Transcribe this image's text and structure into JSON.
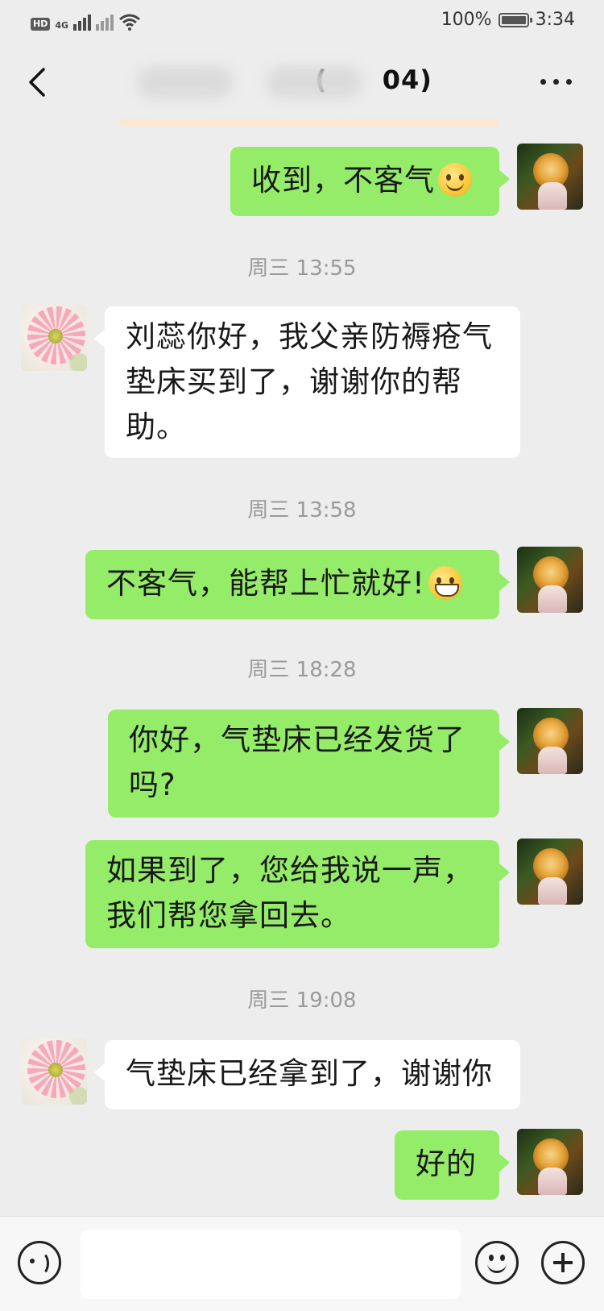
{
  "status_bar": {
    "hd_label": "HD",
    "network_label": "4G",
    "battery_percent": "100%",
    "battery_level": 1.0,
    "time": "3:34"
  },
  "header": {
    "title": "(",
    "title_suffix": "04)",
    "back_icon": "chevron-left-icon",
    "more_icon": "more-dots-icon"
  },
  "messages": [
    {
      "side": "self",
      "text": "收到，不客气",
      "emoji": "smile-emoji"
    },
    {
      "type": "time",
      "text": "周三 13:55"
    },
    {
      "side": "other",
      "lines": [
        "刘蕊你好，我父亲防褥疮气",
        "垫床买到了，谢谢你的帮",
        "助。"
      ]
    },
    {
      "type": "time",
      "text": "周三 13:58"
    },
    {
      "side": "self",
      "text": "不客气，能帮上忙就好!",
      "emoji": "grin-emoji"
    },
    {
      "type": "time",
      "text": "周三 18:28"
    },
    {
      "side": "self",
      "lines": [
        "你好，气垫床已经发货了",
        "吗?"
      ]
    },
    {
      "side": "self",
      "lines": [
        "如果到了，您给我说一声，",
        "我们帮您拿回去。"
      ]
    },
    {
      "type": "time",
      "text": "周三 19:08"
    },
    {
      "side": "other",
      "text": "气垫床已经拿到了，谢谢你"
    },
    {
      "side": "self",
      "text": "好的"
    }
  ],
  "input_bar": {
    "voice_icon": "voice-icon",
    "emoji_icon": "emoji-icon",
    "plus_icon": "plus-icon",
    "input_value": ""
  },
  "colors": {
    "background": "#ededed",
    "self_bubble": "#95ec69",
    "other_bubble": "#ffffff",
    "timestamp": "#9a9a9a"
  }
}
